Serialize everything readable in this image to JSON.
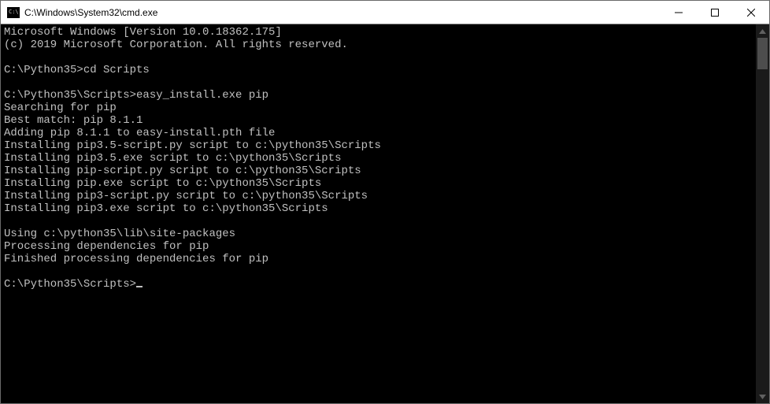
{
  "window": {
    "title": "C:\\Windows\\System32\\cmd.exe"
  },
  "terminal": {
    "lines": [
      "Microsoft Windows [Version 10.0.18362.175]",
      "(c) 2019 Microsoft Corporation. All rights reserved.",
      "",
      "C:\\Python35>cd Scripts",
      "",
      "C:\\Python35\\Scripts>easy_install.exe pip",
      "Searching for pip",
      "Best match: pip 8.1.1",
      "Adding pip 8.1.1 to easy-install.pth file",
      "Installing pip3.5-script.py script to c:\\python35\\Scripts",
      "Installing pip3.5.exe script to c:\\python35\\Scripts",
      "Installing pip-script.py script to c:\\python35\\Scripts",
      "Installing pip.exe script to c:\\python35\\Scripts",
      "Installing pip3-script.py script to c:\\python35\\Scripts",
      "Installing pip3.exe script to c:\\python35\\Scripts",
      "",
      "Using c:\\python35\\lib\\site-packages",
      "Processing dependencies for pip",
      "Finished processing dependencies for pip",
      "",
      "C:\\Python35\\Scripts>"
    ]
  }
}
